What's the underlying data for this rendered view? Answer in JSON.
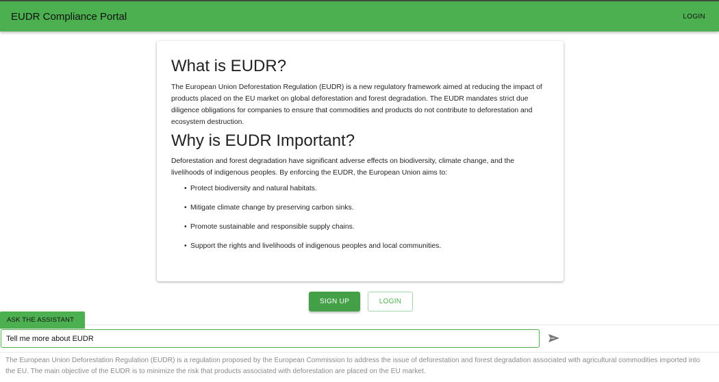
{
  "header": {
    "title": "EUDR Compliance Portal",
    "login_label": "LOGIN"
  },
  "card": {
    "what_heading": "What is EUDR?",
    "what_text": "The European Union Deforestation Regulation (EUDR) is a new regulatory framework aimed at reducing the impact of products placed on the EU market on global deforestation and forest degradation. The EUDR mandates strict due diligence obligations for companies to ensure that commodities and products do not contribute to deforestation and ecosystem destruction.",
    "why_heading": "Why is EUDR Important?",
    "why_text": "Deforestation and forest degradation have significant adverse effects on biodiversity, climate change, and the livelihoods of indigenous peoples. By enforcing the EUDR, the European Union aims to:",
    "benefits": [
      "Protect biodiversity and natural habitats.",
      "Mitigate climate change by preserving carbon sinks.",
      "Promote sustainable and responsible supply chains.",
      "Support the rights and livelihoods of indigenous peoples and local communities."
    ]
  },
  "actions": {
    "signup_label": "SIGN UP",
    "login_label": "LOGIN"
  },
  "assistant": {
    "tab_label": "ASK THE ASSISTANT",
    "input_value": "Tell me more about EUDR",
    "send_icon": "send-icon",
    "answer": "The European Union Deforestation Regulation (EUDR) is a regulation proposed by the European Commission to address the issue of deforestation and forest degradation associated with agricultural commodities imported into the EU. The main objective of the EUDR is to minimize the risk that products associated with deforestation are placed on the EU market."
  },
  "colors": {
    "primary": "#4caf50",
    "primary_dark": "#43a047",
    "muted_text": "#8a8a8a"
  }
}
